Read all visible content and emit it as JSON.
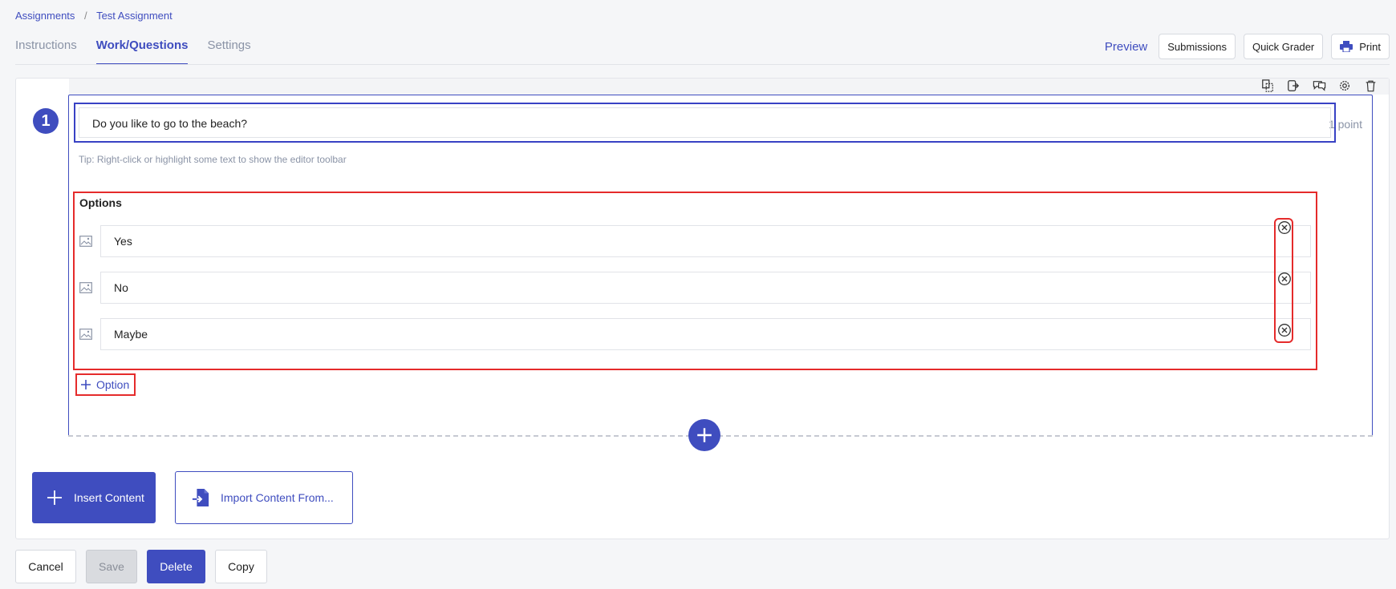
{
  "breadcrumb": {
    "parent": "Assignments",
    "separator": "/",
    "current": "Test Assignment"
  },
  "tabs": [
    {
      "label": "Instructions",
      "active": false
    },
    {
      "label": "Work/Questions",
      "active": true
    },
    {
      "label": "Settings",
      "active": false
    }
  ],
  "header_actions": {
    "preview": "Preview",
    "submissions": "Submissions",
    "quick_grader": "Quick Grader",
    "print": "Print"
  },
  "question": {
    "number": "1",
    "points": "1 point",
    "text": "Do you like to go to the beach?",
    "tip": "Tip: Right-click or highlight some text to show the editor toolbar",
    "options_title": "Options",
    "options": [
      "Yes",
      "No",
      "Maybe"
    ],
    "add_option_label": "Option"
  },
  "content_actions": {
    "insert": "Insert Content",
    "import": "Import Content From..."
  },
  "footer": {
    "cancel": "Cancel",
    "save": "Save",
    "delete": "Delete",
    "copy": "Copy"
  },
  "colors": {
    "accent": "#3f4dbf",
    "highlight_red": "#e52b2b",
    "muted": "#8a93a6"
  }
}
